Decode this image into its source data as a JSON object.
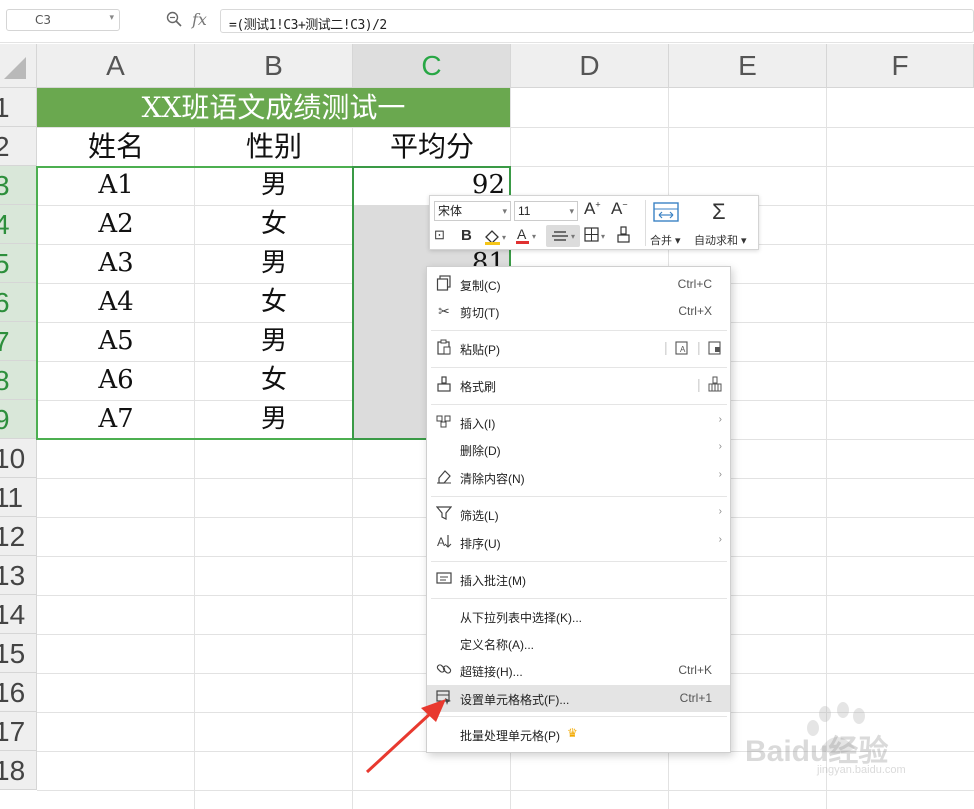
{
  "formula_bar": {
    "name_box": "C3",
    "fx_label": "fx",
    "formula": "=(测试1!C3+测试二!C3)/2"
  },
  "columns": [
    "A",
    "B",
    "C",
    "D",
    "E",
    "F"
  ],
  "rows": [
    "1",
    "2",
    "3",
    "4",
    "5",
    "6",
    "7",
    "8",
    "9",
    "10",
    "11",
    "12",
    "13",
    "14",
    "15",
    "16",
    "17",
    "18"
  ],
  "sheet": {
    "title": "XX班语文成绩测试一",
    "headers": [
      "姓名",
      "性别",
      "平均分"
    ],
    "data": [
      {
        "name": "A1",
        "gender": "男",
        "score": "92"
      },
      {
        "name": "A2",
        "gender": "女",
        "score": ""
      },
      {
        "name": "A3",
        "gender": "男",
        "score": "81"
      },
      {
        "name": "A4",
        "gender": "女",
        "score": ""
      },
      {
        "name": "A5",
        "gender": "男",
        "score": ""
      },
      {
        "name": "A6",
        "gender": "女",
        "score": ""
      },
      {
        "name": "A7",
        "gender": "男",
        "score": ""
      }
    ]
  },
  "mini_toolbar": {
    "font": "宋体",
    "size": "11",
    "merge": "合并",
    "autosum": "自动求和"
  },
  "context_menu": {
    "copy": "复制(C)",
    "copy_sc": "Ctrl+C",
    "cut": "剪切(T)",
    "cut_sc": "Ctrl+X",
    "paste": "粘贴(P)",
    "format_painter": "格式刷",
    "insert": "插入(I)",
    "delete": "删除(D)",
    "clear": "清除内容(N)",
    "filter": "筛选(L)",
    "sort": "排序(U)",
    "insert_comment": "插入批注(M)",
    "pick_list": "从下拉列表中选择(K)...",
    "define_name": "定义名称(A)...",
    "hyperlink": "超链接(H)...",
    "hyperlink_sc": "Ctrl+K",
    "format_cells": "设置单元格格式(F)...",
    "format_cells_sc": "Ctrl+1",
    "batch": "批量处理单元格(P)"
  },
  "watermark": {
    "brand": "Baidu经验",
    "url": "jingyan.baidu.com"
  },
  "colors": {
    "title_fill": "#6aa84f",
    "selection": "#3a9a46",
    "arrow": "#e8392f"
  }
}
